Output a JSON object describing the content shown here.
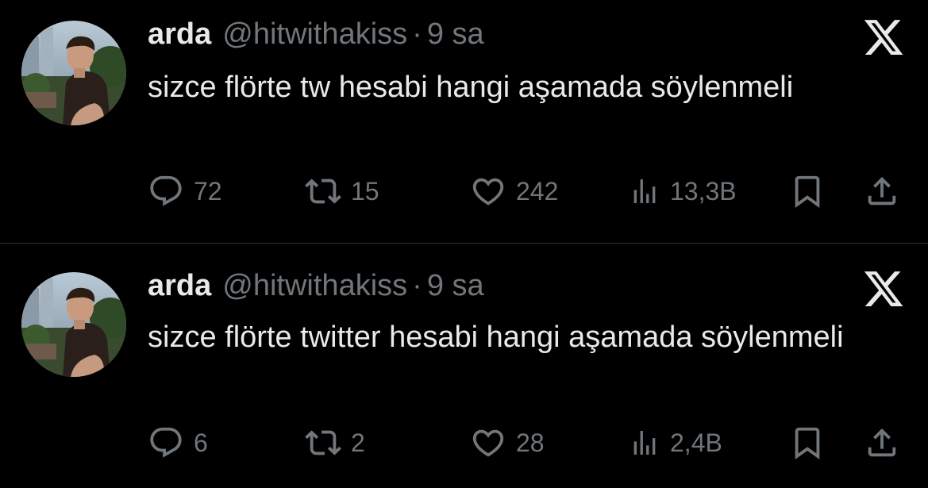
{
  "colors": {
    "background": "#000000",
    "text_primary": "#e7e9ea",
    "text_secondary": "#71767b",
    "divider": "#2f3336"
  },
  "tweets": [
    {
      "author_name": "arda",
      "handle": "@hitwithakiss",
      "separator": "·",
      "time": "9 sa",
      "text": "sizce flörte tw hesabi hangi aşamada söylenmeli",
      "replies": "72",
      "retweets": "15",
      "likes": "242",
      "views": "13,3B",
      "icons": [
        "reply-icon",
        "retweet-icon",
        "like-icon",
        "views-icon",
        "bookmark-icon",
        "share-icon",
        "x-logo-icon"
      ]
    },
    {
      "author_name": "arda",
      "handle": "@hitwithakiss",
      "separator": "·",
      "time": "9 sa",
      "text": "sizce flörte twitter hesabi hangi aşamada söylenmeli",
      "replies": "6",
      "retweets": "2",
      "likes": "28",
      "views": "2,4B",
      "icons": [
        "reply-icon",
        "retweet-icon",
        "like-icon",
        "views-icon",
        "bookmark-icon",
        "share-icon",
        "x-logo-icon"
      ]
    }
  ]
}
